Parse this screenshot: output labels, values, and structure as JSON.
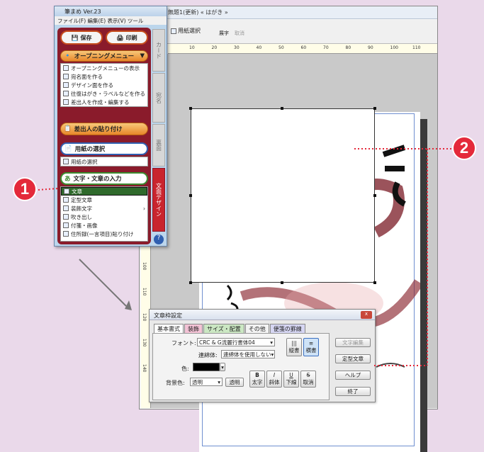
{
  "main_window": {
    "title": "無題1(更新) « はがき »",
    "toolbar": {
      "paper_select": "用紙選択",
      "vertical": "展字",
      "cancel": "取消"
    },
    "ruler_numbers": [
      "10",
      "20",
      "30",
      "40",
      "50",
      "60",
      "70",
      "80",
      "90",
      "100",
      "110"
    ],
    "vruler_numbers": [
      "90",
      "100",
      "110",
      "120",
      "130",
      "140"
    ]
  },
  "menu_window": {
    "title": "筆まめ Ver.23",
    "menubar": "ファイル(F)  編集(E)  表示(V)  ツール",
    "save_label": "保存",
    "print_label": "印刷",
    "opening_menu": "オープニングメニュー",
    "opening_items": [
      "オープニングメニューの表示",
      "宛名面を作る",
      "デザイン面を作る",
      "往復はがき・ラベルなどを作る",
      "差出人を作成・編集する"
    ],
    "sender_paste": "差出人の貼り付け",
    "paper_select": "用紙の選択",
    "paper_items": [
      "用紙の選択"
    ],
    "text_input": "文字・文章の入力",
    "text_items": [
      "文章",
      "定型文章",
      "装飾文字",
      "吹き出し",
      "付箋・画像",
      "住所録(一言項目)貼り付け"
    ],
    "side_tabs": [
      "カード",
      "宛名",
      "裏面",
      "文面デザイン"
    ]
  },
  "dialog": {
    "title": "文章枠設定",
    "tabs": [
      "基本書式",
      "装飾",
      "サイズ・配置",
      "その他",
      "便箋の罫線"
    ],
    "font_label": "フォント:",
    "font_value": "CRC & G流麗行書体04",
    "ren_label": "連綿体:",
    "ren_value": "連綿体を使用しない",
    "tate_btn": "縦書",
    "yoko_btn": "横書",
    "color_label": "色:",
    "bg_label": "背景色:",
    "bg_value": "透明",
    "transparent_btn": "透明",
    "style_btns": [
      "太字",
      "斜体",
      "下線",
      "取消"
    ],
    "style_glyphs": [
      "B",
      "I",
      "U",
      "S"
    ],
    "right_btns": [
      "文字編集",
      "定型文章",
      "ヘルプ",
      "終了"
    ]
  },
  "callouts": {
    "one": "1",
    "two": "2"
  },
  "colors": {
    "accent_red": "#e4293a",
    "panel_red": "#8a1b2b",
    "orange": "#e8872a",
    "selected_green": "#2f6a2c"
  }
}
